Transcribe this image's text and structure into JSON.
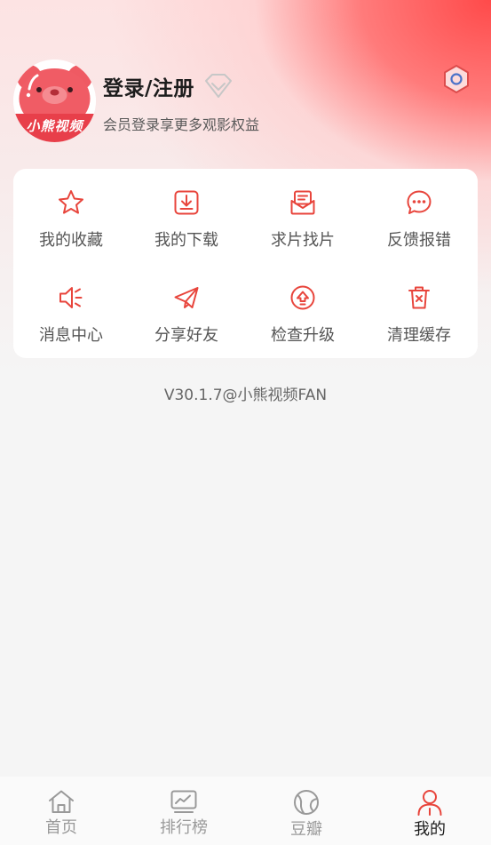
{
  "profile": {
    "logo_text": "小熊视频",
    "login_label": "登录/注册",
    "subtitle": "会员登录享更多观影权益"
  },
  "menu": {
    "items": [
      {
        "label": "我的收藏",
        "icon": "star-icon"
      },
      {
        "label": "我的下载",
        "icon": "download-icon"
      },
      {
        "label": "求片找片",
        "icon": "request-icon"
      },
      {
        "label": "反馈报错",
        "icon": "feedback-icon"
      },
      {
        "label": "消息中心",
        "icon": "speaker-icon"
      },
      {
        "label": "分享好友",
        "icon": "share-icon"
      },
      {
        "label": "检查升级",
        "icon": "upgrade-icon"
      },
      {
        "label": "清理缓存",
        "icon": "trash-icon"
      }
    ]
  },
  "version_text": "V30.1.7@小熊视频FAN",
  "tabbar": {
    "tabs": [
      {
        "label": "首页",
        "icon": "home-icon",
        "active": false
      },
      {
        "label": "排行榜",
        "icon": "chart-icon",
        "active": false
      },
      {
        "label": "豆瓣",
        "icon": "planet-icon",
        "active": false
      },
      {
        "label": "我的",
        "icon": "person-icon",
        "active": true
      }
    ]
  },
  "colors": {
    "accent": "#e8453c",
    "tab_inactive": "#999999",
    "tab_active": "#1d1d1d"
  }
}
